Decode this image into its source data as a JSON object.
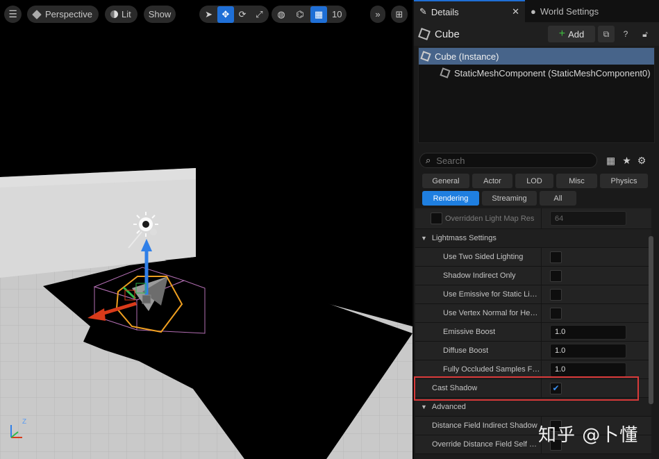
{
  "viewport": {
    "toolbar": {
      "perspective_label": "Perspective",
      "lit_label": "Lit",
      "show_label": "Show",
      "grid_snap_value": "10"
    },
    "axis": {
      "z": "Z"
    }
  },
  "panel": {
    "tabs": [
      {
        "label": "Details",
        "active": true
      },
      {
        "label": "World Settings",
        "active": false
      }
    ],
    "actor_name": "Cube",
    "add_label": "Add",
    "hierarchy": [
      {
        "label": "Cube (Instance)",
        "selected": true
      },
      {
        "label": "StaticMeshComponent (StaticMeshComponent0)",
        "selected": false
      }
    ],
    "search_placeholder": "Search",
    "filters_row1": [
      "General",
      "Actor",
      "LOD",
      "Misc",
      "Physics"
    ],
    "filters_row2": [
      "Rendering",
      "Streaming",
      "All"
    ],
    "active_filter": "Rendering",
    "properties": {
      "overridden_lightmap": {
        "label": "Overridden Light Map Res",
        "value": "64"
      },
      "lightmass_category": "Lightmass Settings",
      "two_sided": {
        "label": "Use Two Sided Lighting",
        "checked": false
      },
      "shadow_indirect": {
        "label": "Shadow Indirect Only",
        "checked": false
      },
      "emissive_static": {
        "label": "Use Emissive for Static Lighting",
        "checked": false
      },
      "vertex_normal": {
        "label": "Use Vertex Normal for Hemisphere Gather",
        "checked": false
      },
      "emissive_boost": {
        "label": "Emissive Boost",
        "value": "1.0"
      },
      "diffuse_boost": {
        "label": "Diffuse Boost",
        "value": "1.0"
      },
      "occluded_samples": {
        "label": "Fully Occluded Samples Fraction",
        "value": "1.0"
      },
      "cast_shadow": {
        "label": "Cast Shadow",
        "checked": true
      },
      "advanced_category": "Advanced",
      "df_indirect": {
        "label": "Distance Field Indirect Shadow",
        "checked": false
      },
      "df_self_shadow": {
        "label": "Override Distance Field Self Shadow Bias",
        "checked": false
      }
    }
  },
  "watermark": "知乎 @卜懂",
  "colors": {
    "accent": "#1f7fe0",
    "selection": "#47648a",
    "highlight_box": "#d93a3a",
    "gizmo_z": "#2f7fe8",
    "gizmo_x": "#d83a1a",
    "select_outline": "#f0a020"
  }
}
